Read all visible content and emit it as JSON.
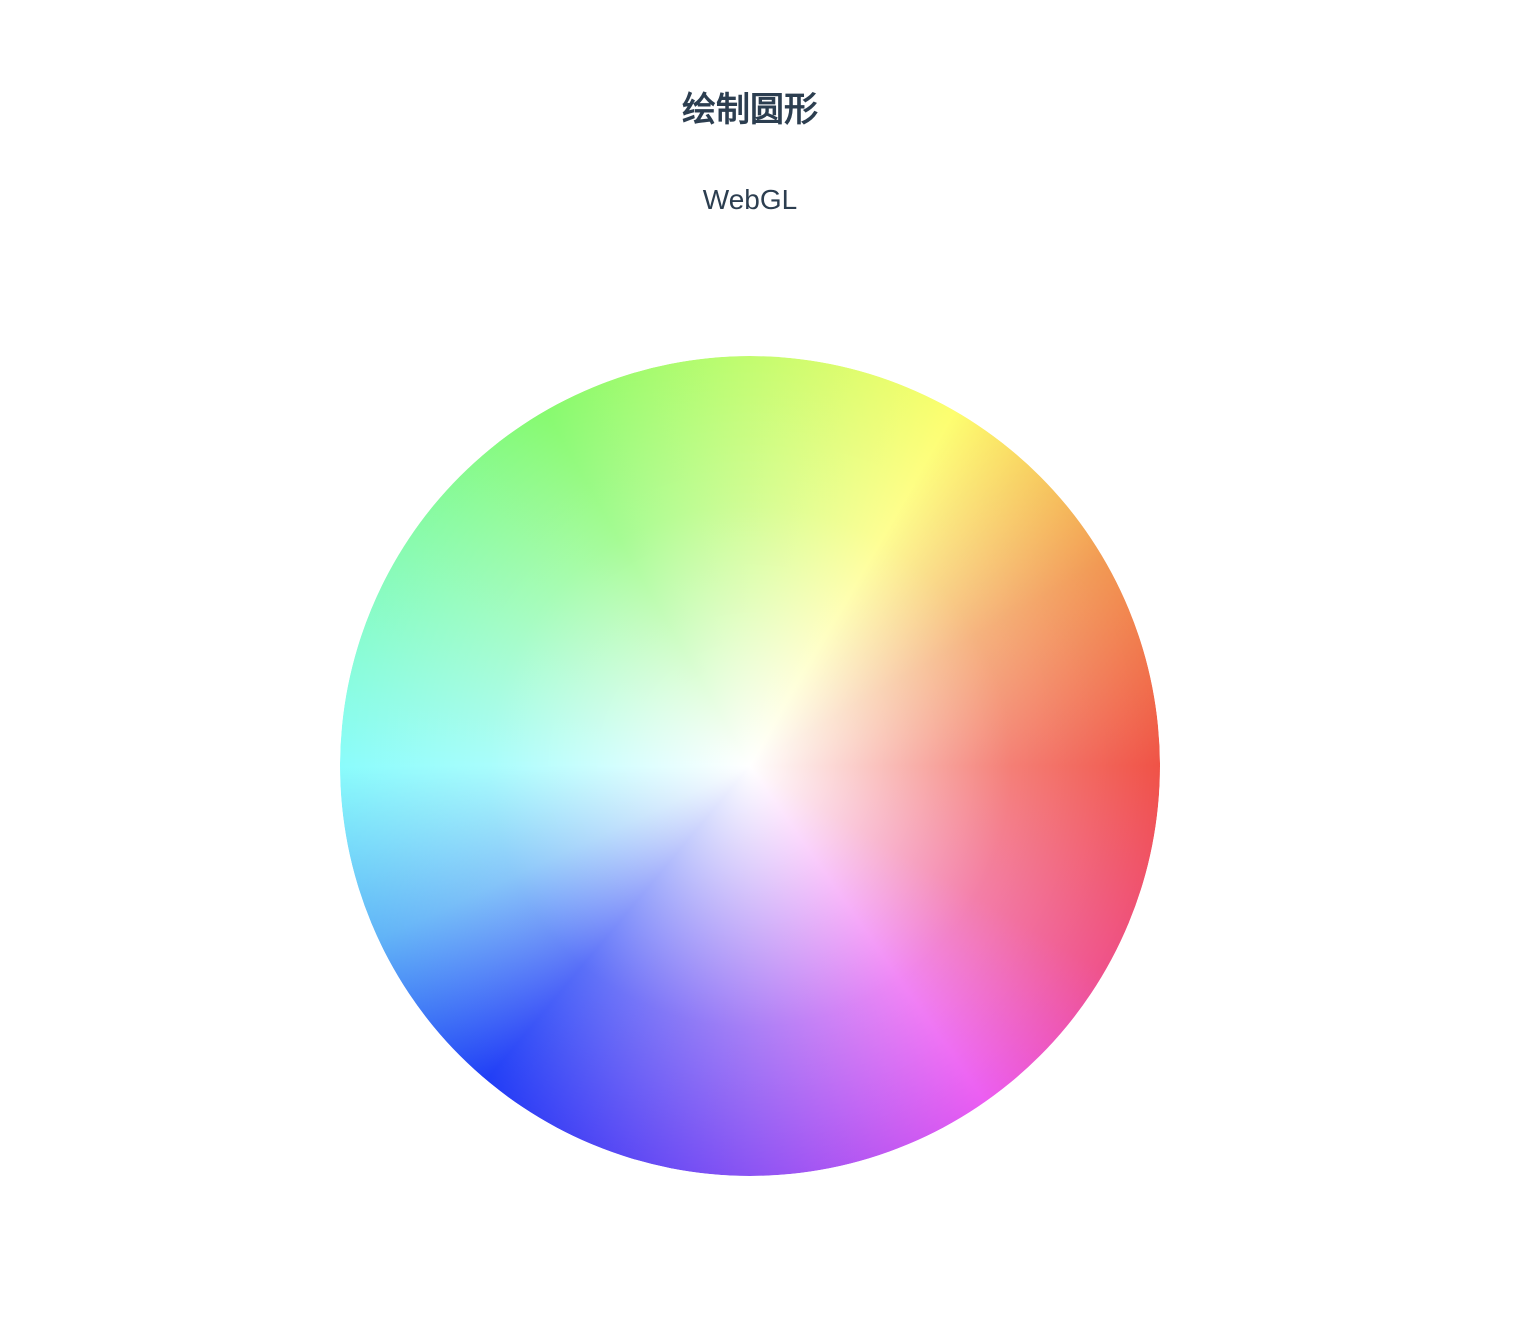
{
  "page": {
    "title": "绘制圆形",
    "subtitle": "WebGL"
  },
  "canvas": {
    "shape": "circle",
    "fill": "conic-hue-gradient",
    "colors": [
      "#ee3a2c",
      "#ed3a7a",
      "#e946f0",
      "#7a3bf1",
      "#0022f5",
      "#4aa8f6",
      "#7afcfb",
      "#76f95b",
      "#fdfe5a",
      "#f08a3a"
    ]
  }
}
